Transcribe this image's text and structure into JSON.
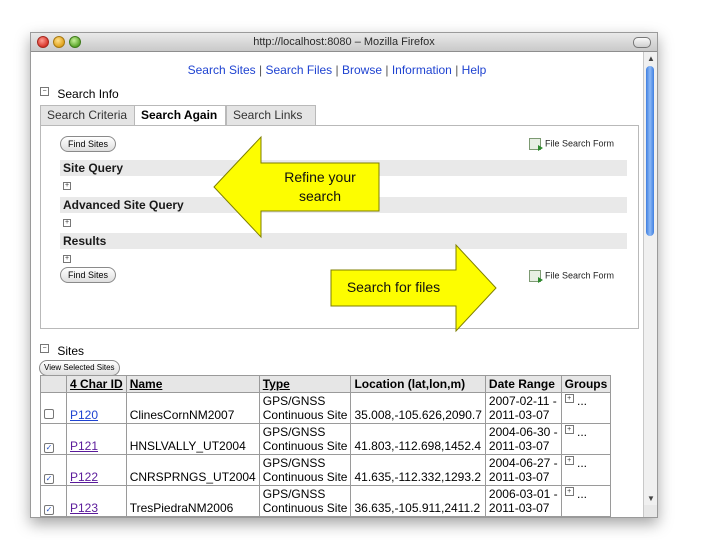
{
  "window": {
    "title": "http://localhost:8080 – Mozilla Firefox"
  },
  "nav": {
    "links": [
      "Search Sites",
      "Search Files",
      "Browse",
      "Information",
      "Help"
    ],
    "separator": "|"
  },
  "search_info": {
    "heading": "Search Info",
    "toggle": "−",
    "tabs": [
      "Search Criteria",
      "Search Again",
      "Search Links"
    ],
    "find_sites_label": "Find Sites",
    "file_search_form_label": "File Search Form",
    "sections": [
      "Site Query",
      "Advanced Site Query",
      "Results"
    ],
    "expand_symbol": "+"
  },
  "callouts": {
    "refine": [
      "Refine your",
      "search"
    ],
    "files": "Search for files",
    "color": "#fdfd00"
  },
  "sites": {
    "heading": "Sites",
    "toggle": "−",
    "view_selected_label": "View Selected Sites",
    "columns": [
      "4 Char ID",
      "Name",
      "Type",
      "Location (lat,lon,m)",
      "Date Range",
      "Groups"
    ],
    "rows": [
      {
        "checked": false,
        "id": "P120",
        "name": "ClinesCornNM2007",
        "type1": "GPS/GNSS",
        "type2": "Continuous Site",
        "location": "35.008,-105.626,2090.7",
        "date1": "2007-02-11 -",
        "date2": "2011-03-07",
        "groups": "..."
      },
      {
        "checked": true,
        "id": "P121",
        "name": "HNSLVALLY_UT2004",
        "type1": "GPS/GNSS",
        "type2": "Continuous Site",
        "location": "41.803,-112.698,1452.4",
        "date1": "2004-06-30 -",
        "date2": "2011-03-07",
        "groups": "..."
      },
      {
        "checked": true,
        "id": "P122",
        "name": "CNRSPRNGS_UT2004",
        "type1": "GPS/GNSS",
        "type2": "Continuous Site",
        "location": "41.635,-112.332,1293.2",
        "date1": "2004-06-27 -",
        "date2": "2011-03-07",
        "groups": "..."
      },
      {
        "checked": true,
        "id": "P123",
        "name": "TresPiedraNM2006",
        "type1": "GPS/GNSS",
        "type2": "Continuous Site",
        "location": "36.635,-105.911,2411.2",
        "date1": "2006-03-01 -",
        "date2": "2011-03-07",
        "groups": "..."
      }
    ]
  }
}
